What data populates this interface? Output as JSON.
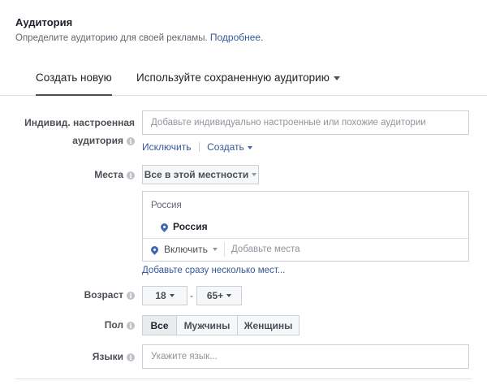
{
  "header": {
    "title": "Аудитория",
    "subtitle": "Определите аудиторию для своей рекламы.",
    "more_link": "Подробнее."
  },
  "tabs": [
    {
      "label": "Создать новую",
      "active": true
    },
    {
      "label": "Используйте сохраненную аудиторию",
      "active": false
    }
  ],
  "custom_audience": {
    "label_line1": "Индивид. настроенная",
    "label_line2": "аудитория",
    "placeholder": "Добавьте индивидуально настроенные или похожие аудитории",
    "exclude_link": "Исключить",
    "create_link": "Создать"
  },
  "locations": {
    "label": "Места",
    "dropdown_value": "Все в этой местности",
    "group_header": "Россия",
    "selected_location": "Россия",
    "include_value": "Включить",
    "add_placeholder": "Добавьте места",
    "bulk_link": "Добавьте сразу несколько мест..."
  },
  "age": {
    "label": "Возраст",
    "min": "18",
    "separator": "-",
    "max": "65+"
  },
  "gender": {
    "label": "Пол",
    "options": [
      "Все",
      "Мужчины",
      "Женщины"
    ],
    "selected": "Все"
  },
  "languages": {
    "label": "Языки",
    "placeholder": "Укажите язык..."
  },
  "colors": {
    "link": "#365899",
    "accent": "#4267b2",
    "label": "#4b4f56",
    "border": "#ccd0d5"
  }
}
